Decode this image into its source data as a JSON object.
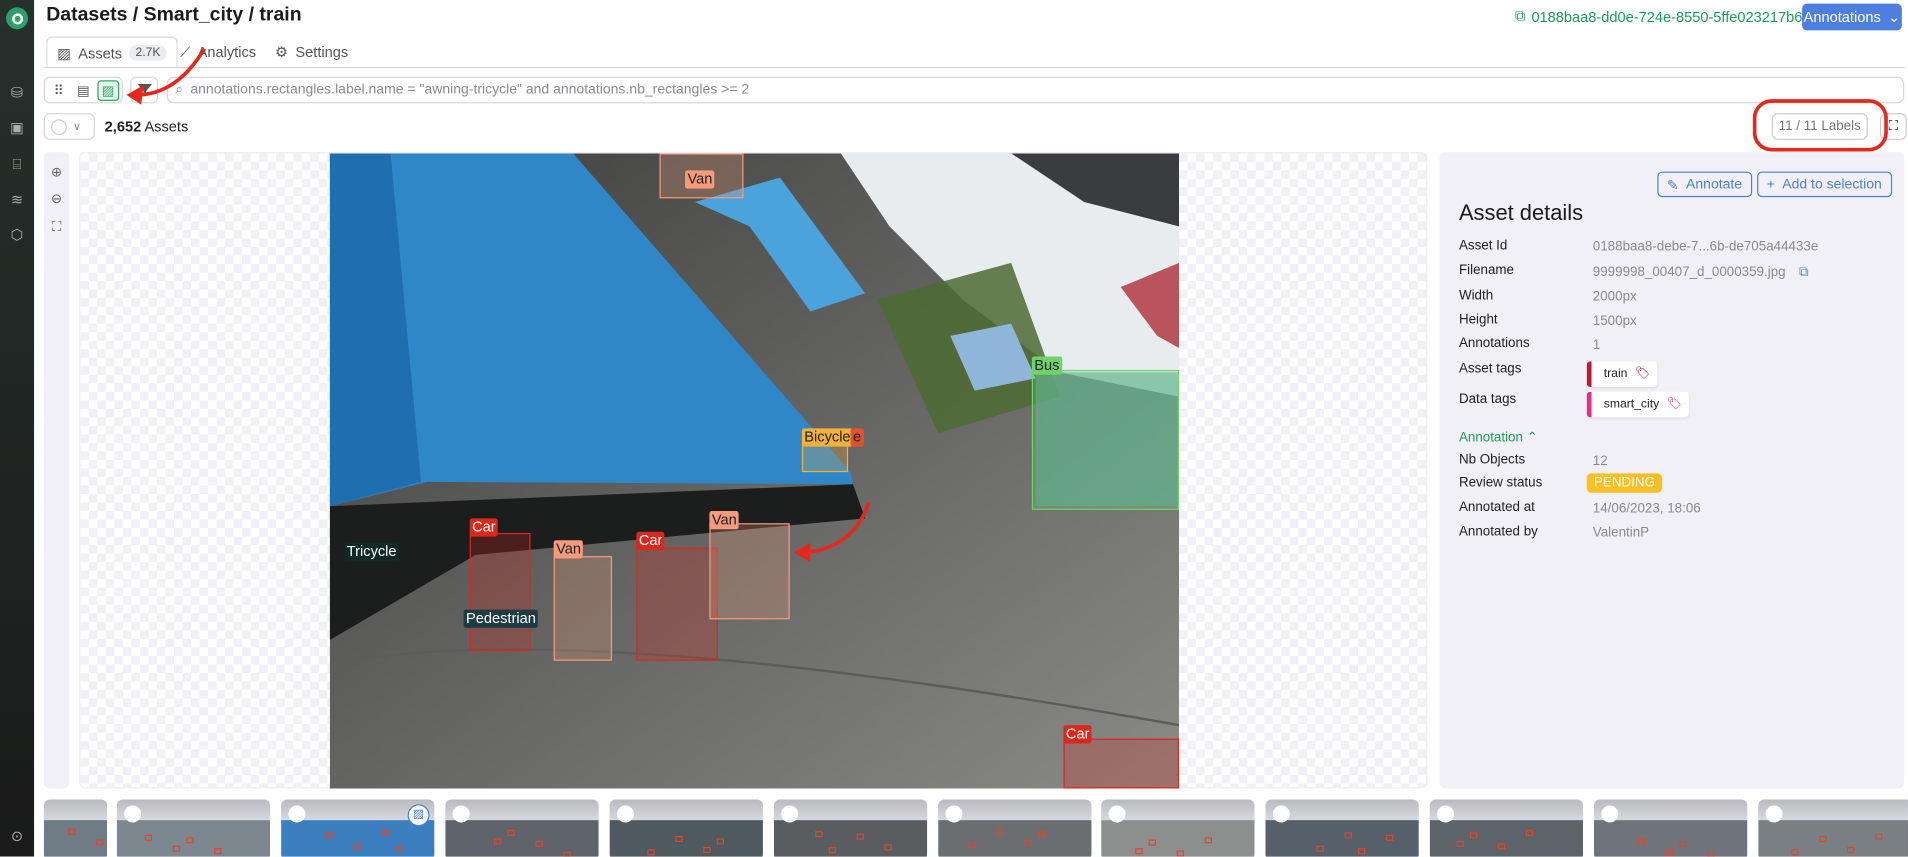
{
  "header": {
    "breadcrumb": "Datasets / Smart_city / train",
    "dataset_id": "0188baa8-dd0e-724e-8550-5ffe023217b6",
    "annotations_button": "Annotations"
  },
  "tabs": [
    {
      "label": "Assets",
      "badge": "2.7K",
      "active": true
    },
    {
      "label": "Analytics"
    },
    {
      "label": "Settings"
    }
  ],
  "toolbar": {
    "view_modes": [
      "grid",
      "table",
      "image"
    ],
    "active_view": "image",
    "search_query": "annotations.rectangles.label.name = \"awning-tricycle\" and annotations.nb_rectangles >= 2"
  },
  "summary": {
    "count": "2,652",
    "count_suffix": " Assets",
    "labels_button": "11 / 11 Labels"
  },
  "viewer": {
    "annotations": [
      {
        "label": "Van",
        "color": "#f59a7c"
      },
      {
        "label": "Bus",
        "color": "#6fd36a"
      },
      {
        "label": "Bicycle",
        "color": "#f2b13a"
      },
      {
        "label": "e",
        "color": "#e2522f"
      },
      {
        "label": "Car",
        "color": "#d9281e"
      },
      {
        "label": "Pedestrian",
        "color": "#1f3b45"
      },
      {
        "label": "Van",
        "color": "#f59a7c"
      },
      {
        "label": "Car",
        "color": "#d9281e"
      },
      {
        "label": "Van",
        "color": "#f59a7c"
      },
      {
        "label": "Tricycle",
        "color": "#0f2a22"
      },
      {
        "label": "Car",
        "color": "#d9281e"
      }
    ]
  },
  "details": {
    "annotate_button": "Annotate",
    "add_selection_button": "Add to selection",
    "title": "Asset details",
    "fields": [
      {
        "key": "Asset Id",
        "value": "0188baa8-debe-7...6b-de705a44433e"
      },
      {
        "key": "Filename",
        "value": "9999998_00407_d_0000359.jpg"
      },
      {
        "key": "Width",
        "value": "2000px"
      },
      {
        "key": "Height",
        "value": "1500px"
      },
      {
        "key": "Annotations",
        "value": "1"
      }
    ],
    "asset_tags_label": "Asset tags",
    "asset_tag": "train",
    "asset_tag_color": "#c2133a",
    "data_tags_label": "Data tags",
    "data_tag": "smart_city",
    "data_tag_color": "#ec2a8a",
    "annotation_header": "Annotation",
    "annotation_fields": [
      {
        "key": "Nb Objects",
        "value": "12"
      },
      {
        "key": "Review status",
        "value": "PENDING"
      },
      {
        "key": "Annotated at",
        "value": "14/06/2023, 18:06"
      },
      {
        "key": "Annotated by",
        "value": "ValentinP"
      }
    ]
  }
}
